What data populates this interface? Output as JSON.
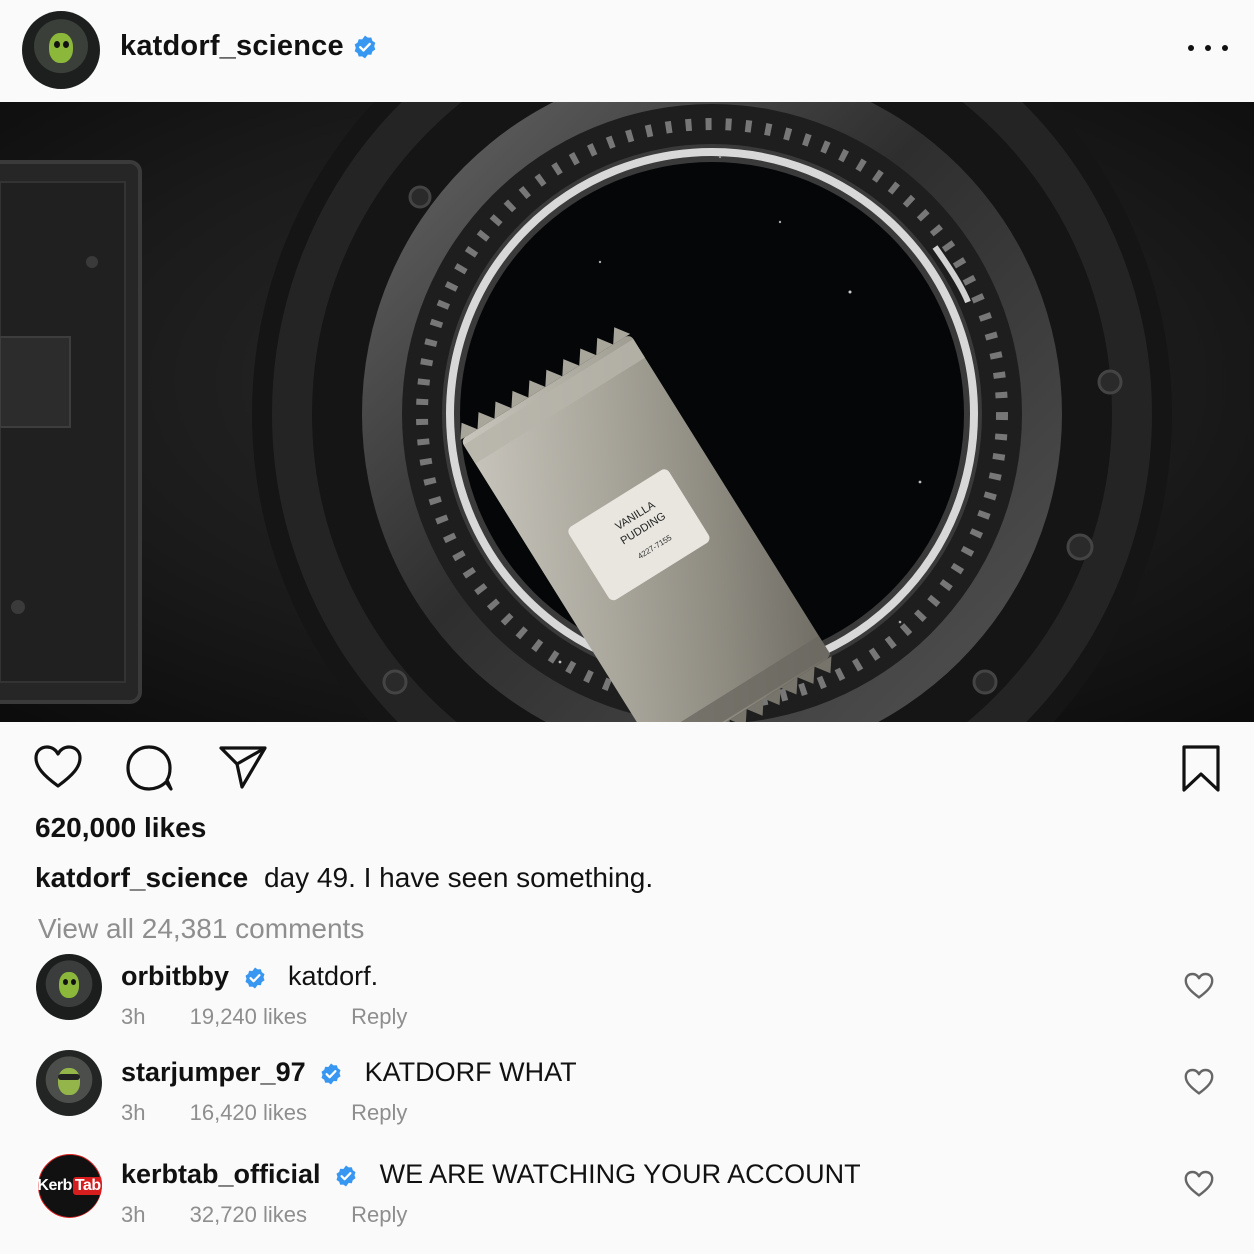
{
  "post": {
    "author": "katdorf_science",
    "author_verified": true,
    "likes_text": "620,000 likes",
    "caption_user": "katdorf_science",
    "caption_text": "day 49. I have seen something.",
    "view_all_comments": "View all 24,381 comments",
    "image": {
      "description_icon": "photo",
      "package_label_line1": "VANILLA",
      "package_label_line2": "PUDDING",
      "package_label_code": "4227-7155"
    }
  },
  "icons": {
    "like": "heart-icon",
    "comment": "comment-bubble-icon",
    "share": "send-icon",
    "save": "bookmark-icon",
    "more": "more-horizontal-icon",
    "verified": "verified-badge-icon"
  },
  "colors": {
    "verified_blue": "#3897f0",
    "meta_gray": "#8e8e8e",
    "kerbtab_red": "#d71e1e"
  },
  "comments": [
    {
      "user": "orbitbby",
      "verified": true,
      "text": "katdorf.",
      "time": "3h",
      "likes": "19,240 likes",
      "reply": "Reply"
    },
    {
      "user": "starjumper_97",
      "verified": true,
      "text": "KATDORF WHAT",
      "time": "3h",
      "likes": "16,420 likes",
      "reply": "Reply"
    },
    {
      "user": "kerbtab_official",
      "verified": true,
      "text": "WE ARE WATCHING YOUR ACCOUNT",
      "time": "3h",
      "likes": "32,720 likes",
      "reply": "Reply",
      "avatar_text_a": "Kerb",
      "avatar_text_b": "Tab"
    }
  ]
}
